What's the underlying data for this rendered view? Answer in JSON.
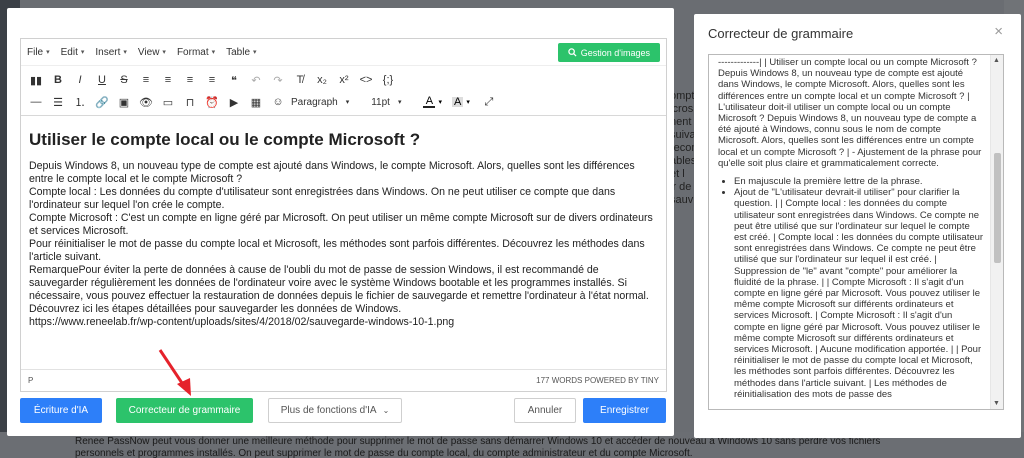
{
  "background": {
    "right_fragments": [
      "ompte",
      "icros",
      "nent s",
      "suivant",
      "recommand",
      "ables et l",
      "ir de sauv"
    ],
    "bottom_lines": [
      "Renee PassNow peut vous donner une meilleure méthode pour supprimer le mot de passe sans démarrer Windows 10 et accéder de nouveau à Windows 10 sans perdre vos fichiers",
      "personnels et programmes installés. On peut supprimer le mot de passe du compte local, du compte administrateur et du compte Microsoft."
    ]
  },
  "editor": {
    "menu": [
      "File",
      "Edit",
      "Insert",
      "View",
      "Format",
      "Table"
    ],
    "gallery_button": "Gestion d'images",
    "toolbar": {
      "row1": [
        "bookmark-icon",
        "bold-icon",
        "italic-icon",
        "underline-icon",
        "strikethrough-icon",
        "align-left-icon",
        "align-center-icon",
        "align-right-icon",
        "align-justify-icon",
        "blockquote-icon",
        "undo-icon",
        "redo-icon",
        "clear-format-icon",
        "subscript-icon",
        "superscript-icon",
        "code-icon",
        "template-icon"
      ],
      "row1_glyphs": [
        "▮▮",
        "B",
        "I",
        "U",
        "S",
        "≡",
        "≡",
        "≡",
        "≡",
        "❝",
        "↶",
        "↷",
        "T̸",
        "x₂",
        "x²",
        "<>",
        "{;}"
      ],
      "row2_glyphs": [
        "—",
        "☰",
        "⒈",
        "🔗",
        "▣",
        "👁",
        "▭",
        "⊓",
        "⏰",
        "▶",
        "▦",
        "☺"
      ],
      "row2": [
        "hr-icon",
        "bullet-list-icon",
        "numbered-list-icon",
        "link-icon",
        "image-icon",
        "preview-icon",
        "page-icon",
        "bookmark-flag-icon",
        "clock-icon",
        "media-icon",
        "table-icon",
        "emoji-icon"
      ],
      "block_format": "Paragraph",
      "font_size": "11pt",
      "text_color_letter": "A",
      "bg_color_letter": "A",
      "fullscreen_glyph": "⤢"
    },
    "heading": "Utiliser le compte local ou le compte Microsoft ?",
    "paragraphs": [
      "Depuis Windows 8, un nouveau type de compte est ajouté dans Windows, le compte Microsoft. Alors, quelles sont les différences entre le compte local et le compte Microsoft ?",
      "Compte local : Les données du compte d'utilisateur sont enregistrées dans Windows. On ne peut utiliser ce compte que dans l'ordinateur sur lequel l'on crée le compte.",
      "Compte Microsoft : C'est un compte en ligne géré par Microsoft. On peut utiliser un même compte Microsoft sur de divers ordinateurs et services Microsoft.",
      "Pour réinitialiser le mot de passe du compte local et Microsoft, les méthodes sont parfois différentes. Découvrez les méthodes dans l'article suivant.",
      "RemarquePour éviter la perte de données à cause de l'oubli du mot de passe de session Windows, il est recommandé de sauvegarder régulièrement les données de l'ordinateur voire avec le système Windows bootable et les programmes installés. Si nécessaire, vous pouvez effectuer la restauration de données depuis le fichier de sauvegarde et remettre l'ordinateur à l'état normal.",
      "Découvrez ici les étapes détaillées pour sauvegarder les données de Windows.",
      "https://www.reneelab.fr/wp-content/uploads/sites/4/2018/02/sauvegarde-windows-10-1.png"
    ],
    "status_path": "P",
    "status_words": "177 WORDS POWERED BY TINY"
  },
  "buttons": {
    "ai_writing": "Écriture d'IA",
    "grammar": "Correcteur de grammaire",
    "more_ai": "Plus de fonctions d'IA",
    "cancel": "Annuler",
    "save": "Enregistrer"
  },
  "panel": {
    "title": "Correcteur de grammaire",
    "close": "×",
    "intro": "-------------| | Utiliser un compte local ou un compte Microsoft ? Depuis Windows 8, un nouveau type de compte est ajouté dans Windows, le compte Microsoft. Alors, quelles sont les différences entre un compte local et un compte Microsoft ? | L'utilisateur doit-il utiliser un compte local ou un compte Microsoft ? Depuis Windows 8, un nouveau type de compte a été ajouté à Windows, connu sous le nom de compte Microsoft. Alors, quelles sont les différences entre un compte local et un compte Microsoft ? | - Ajustement de la phrase pour qu'elle soit plus claire et grammaticalement correcte.",
    "bullets": [
      "En majuscule la première lettre de la phrase.",
      "Ajout de \"L'utilisateur devrait-il utiliser\" pour clarifier la question. | | Compte local : les données du compte utilisateur sont enregistrées dans Windows. Ce compte ne peut être utilisé que sur l'ordinateur sur lequel le compte est créé. | Compte local : les données du compte utilisateur sont enregistrées dans Windows. Ce compte ne peut être utilisé que sur l'ordinateur sur lequel il est créé. | Suppression de \"le\" avant \"compte\" pour améliorer la fluidité de la phrase. | | Compte Microsoft : Il s'agit d'un compte en ligne géré par Microsoft. Vous pouvez utiliser le même compte Microsoft sur différents ordinateurs et services Microsoft. | Compte Microsoft : Il s'agit d'un compte en ligne géré par Microsoft. Vous pouvez utiliser le même compte Microsoft sur différents ordinateurs et services Microsoft. | Aucune modification apportée. | | Pour réinitialiser le mot de passe du compte local et Microsoft, les méthodes sont parfois différentes. Découvrez les méthodes dans l'article suivant. | Les méthodes de réinitialisation des mots de passe des"
    ]
  },
  "colors": {
    "blue": "#2d7ff9",
    "green": "#2cc36b",
    "arrow": "#e5222b"
  }
}
